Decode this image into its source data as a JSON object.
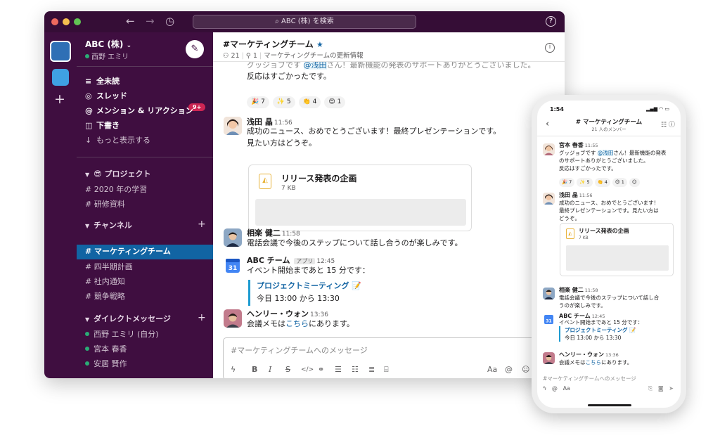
{
  "desktop": {
    "search_placeholder": "ABC (株) を検索",
    "help_icon": "?",
    "workspace": {
      "name": "ABC (株)",
      "user": "西野 エミリ"
    },
    "nav": {
      "all_unreads": "全未読",
      "threads": "スレッド",
      "threads_badge": "9+",
      "mentions": "メンション & リアクション",
      "drafts": "下書き",
      "show_more": "もっと表示する"
    },
    "project_section": {
      "title": "😎 プロジェクト",
      "channels": [
        "2020 年の学習",
        "研修資料"
      ]
    },
    "channel_section": {
      "title": "チャンネル",
      "channels": [
        "マーケティングチーム",
        "四半期計画",
        "社内通知",
        "競争戦略"
      ]
    },
    "dm_section": {
      "title": "ダイレクトメッセージ",
      "people": [
        "西野 エミリ (自分)",
        "宮本 春香",
        "安居 賢作"
      ]
    },
    "channel_header": {
      "title": "#マーケティングチーム",
      "members": "21",
      "pins": "1",
      "topic": "マーケティングチームの更新情報"
    },
    "messages": {
      "m1_line1_pre": "グッジョブです ",
      "m1_mention": "@浅田",
      "m1_line1_post": "さん！最新機能の発表のサポートありがとうございました。",
      "m1_line2": "反応はすごかったです。",
      "reactions": [
        "🎉 7",
        "✨ 5",
        "👏 4",
        "😍 1"
      ],
      "m2_name": "浅田 晶",
      "m2_time": "11:56",
      "m2_line1": "成功のニュース、おめでとうございます！最終プレゼンテーションです。",
      "m2_line2": "見たい方はどうぞ。",
      "file_name": "リリース発表の企画",
      "file_size": "7 KB",
      "m3_name": "相楽 健二",
      "m3_time": "11:58",
      "m3_text": "電話会議で今後のステップについて話し合うのが楽しみです。",
      "m4_name": "ABC チーム",
      "m4_tag": "アプリ",
      "m4_time": "12:45",
      "m4_text": "イベント開始まであと 15 分です：",
      "event_title": "プロジェクトミーティング 📝",
      "event_time": "今日 13:00 から 13:30",
      "calendar_day": "31",
      "m5_name": "ヘンリー・ウォン",
      "m5_time": "13:36",
      "m5_pre": "会議メモは",
      "m5_link": "こちら",
      "m5_post": "にあります。"
    },
    "composer_placeholder": "#マーケティングチームへのメッセージ"
  },
  "mobile": {
    "clock": "1:54",
    "title": "# マーケティングチーム",
    "subtitle": "21 人のメンバー",
    "m1_name": "宮本 春香",
    "m1_time": "11:55",
    "m1_line1_pre": "グッジョブです ",
    "m1_mention": "@浅田",
    "m1_line1_post": "さん！最新機能の発表",
    "m1_line2": "のサポートありがとうございました。",
    "m1_line3": "反応はすごかったです。",
    "reactions": [
      "🎉 7",
      "✨ 5",
      "👏 4",
      "😍 1"
    ],
    "m2_name": "浅田 晶",
    "m2_time": "11:56",
    "m2_line1": "成功のニュース、おめでとうございます！",
    "m2_line2": "最終プレゼンテーションです。見たい方は",
    "m2_line3": "どうぞ。",
    "file_name": "リリース発表の企画",
    "file_size": "7 KB",
    "m3_name": "相楽 健二",
    "m3_time": "11:58",
    "m3_line1": "電話会議で今後のステップについて話し合",
    "m3_line2": "うのが楽しみです。",
    "m4_name": "ABC チーム",
    "m4_time": "12:45",
    "m4_text": "イベント開始まであと 15 分です：",
    "event_title": "プロジェクトミーティング 📝",
    "event_time": "今日 13:00 から 13:30",
    "calendar_day": "31",
    "m5_name": "ヘンリー・ウォン",
    "m5_time": "13:36",
    "m5_pre": "会議メモは",
    "m5_link": "こちら",
    "m5_post": "にあります。",
    "composer_placeholder": "#マーケティングチームへのメッセージ",
    "font_button": "Aa"
  },
  "colors": {
    "sidebar": "#3f0e40",
    "titlebar": "#350d36",
    "active": "#1164a3",
    "link": "#1264a3",
    "badge": "#cd2553",
    "online": "#2bac76"
  }
}
